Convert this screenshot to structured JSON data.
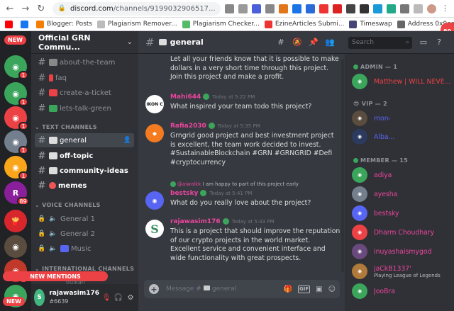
{
  "browser": {
    "url_main": "discord.com",
    "url_tail": "/channels/9199032906517...",
    "bookmarks": [
      "Blogger: Posts",
      "Plagiarism Remover...",
      "Plagiarism Checker...",
      "EzineArticles Submi...",
      "Timeswap",
      "Address 0x9ea5150..."
    ],
    "corner_badge": "80"
  },
  "servers": {
    "new_top": "NEW",
    "new_bottom": "NEW",
    "new_mentions": "NEW MENTIONS",
    "badge_89": "89",
    "badge_1": "1"
  },
  "guild": {
    "name": "Official GRN Commu...",
    "channels_pinned": [
      "about-the-team",
      "faq",
      "create-a-ticket",
      "lets-talk-green"
    ],
    "cat_text": "TEXT CHANNELS",
    "text_channels": [
      "general",
      "off-topic",
      "community-ideas",
      "memes"
    ],
    "cat_voice": "VOICE CHANNELS",
    "voice_channels": [
      "General 1",
      "General 2",
      "Music"
    ],
    "cat_intl": "INTERNATIONAL CHANNELS",
    "intl_partial": "bulkan"
  },
  "user": {
    "name": "rajawasim176",
    "tag": "#6639"
  },
  "header": {
    "channel": "general",
    "search_placeholder": "Search"
  },
  "messages": [
    {
      "body": "Let all your friends know that it is possible to make dollars in a very short time through this project. Join this project and make a profit."
    },
    {
      "author": "Mahi644",
      "time": "Today at 5:22 PM",
      "avatar": "IKON C",
      "body": "What inspired your team todo this project?"
    },
    {
      "author": "Rafia2030",
      "time": "Today at 5:35 PM",
      "body": "Grngrid good project and best investment project is excellent, the team work  decided to invest. #SustainableBlockchain #GRN #GRNGRID #Defi #cryptocurrency"
    },
    {
      "reply_user": "@aiwalkk",
      "reply_text": "I am happy to part of this project early",
      "author": "bestsky",
      "time": "Today at 5:41 PM",
      "body": "What do you really love about the project?"
    },
    {
      "author": "rajawasim176",
      "time": "Today at 5:43 PM",
      "avatar": "S",
      "body": "This is a project that should improve the reputation of our crypto projects in the world market. Excellent service and convenient interface and wide functionality with great prospects."
    }
  ],
  "composer": {
    "placeholder": "Message #",
    "channel": "general",
    "gif": "GIF"
  },
  "members": {
    "admin_cat": "ADMIN — 1",
    "admin": [
      {
        "name": "Matthew | WILL NEVE...",
        "color": "#ed4245"
      }
    ],
    "vip_cat": "VIP — 2",
    "vip": [
      {
        "name": "mono...",
        "color": "#5865f2",
        "extra": "♛"
      },
      {
        "name": "Alba...",
        "color": "#5865f2"
      }
    ],
    "member_cat": "MEMBER — 15",
    "member": [
      {
        "name": "adiya",
        "color": "#eb459e"
      },
      {
        "name": "ayesha",
        "color": "#eb459e"
      },
      {
        "name": "bestsky",
        "color": "#eb459e"
      },
      {
        "name": "Dharm Choudhary",
        "color": "#eb459e"
      },
      {
        "name": "inuyashaismygod",
        "color": "#eb459e"
      },
      {
        "name": "jaCkB1337'",
        "color": "#eb459e",
        "activity": "Playing League of Legends"
      },
      {
        "name": "JooBra",
        "color": "#eb459e"
      }
    ]
  }
}
